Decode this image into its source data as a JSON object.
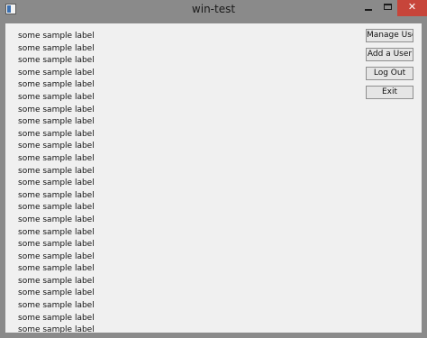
{
  "window": {
    "title": "win-test",
    "close_glyph": "✕"
  },
  "buttons": {
    "manage_users": "Manage Users",
    "add_user": "Add a User",
    "log_out": "Log Out",
    "exit": "Exit"
  },
  "labels": [
    "some sample label",
    "some sample label",
    "some sample label",
    "some sample label",
    "some sample label",
    "some sample label",
    "some sample label",
    "some sample label",
    "some sample label",
    "some sample label",
    "some sample label",
    "some sample label",
    "some sample label",
    "some sample label",
    "some sample label",
    "some sample label",
    "some sample label",
    "some sample label",
    "some sample label",
    "some sample label",
    "some sample label",
    "some sample label",
    "some sample label",
    "some sample label",
    "some sample label"
  ],
  "colors": {
    "titlebar": "#8a8a8a",
    "close_button": "#c7453a",
    "client_background": "#f0f0f0"
  },
  "icons": {
    "app": "app-icon",
    "minimize": "minimize-icon",
    "maximize": "maximize-icon",
    "close": "close-icon"
  }
}
